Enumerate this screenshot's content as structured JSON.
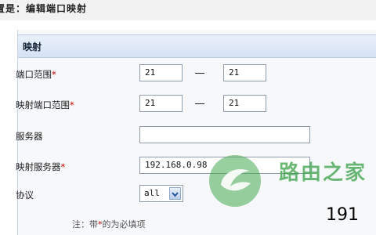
{
  "breadcrumb": "置是：编辑端口映射",
  "panel_title": "映射",
  "fields": {
    "port_range": {
      "label": "端口范围",
      "from": "21",
      "to": "21"
    },
    "mapped_port_range": {
      "label": "映射端口范围",
      "from": "21",
      "to": "21"
    },
    "server": {
      "label": "服务器",
      "value": ""
    },
    "mapped_server": {
      "label": "映射服务器",
      "value": "192.168.0.98"
    },
    "protocol": {
      "label": "协议",
      "value": "all"
    }
  },
  "required_mark": "*",
  "note": {
    "prefix": "注：带",
    "mark": "*",
    "suffix": "的为必填项"
  },
  "watermark": {
    "text": "路由之家",
    "number": "191"
  },
  "colors": {
    "required": "#cc0000",
    "watermark_green": "#38a046",
    "panel_head": "#d6e3f4"
  }
}
